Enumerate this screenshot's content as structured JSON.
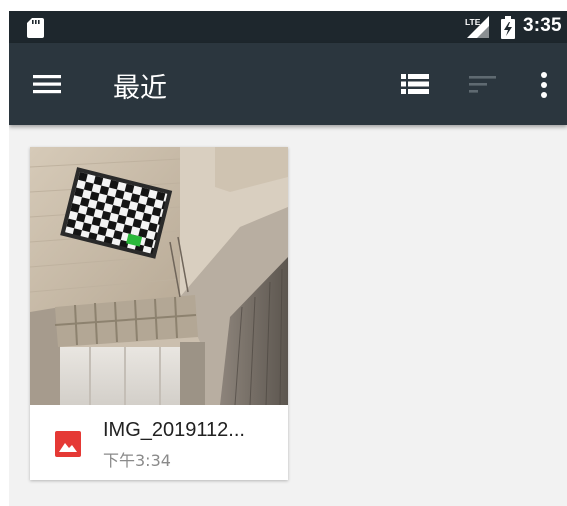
{
  "status_bar": {
    "time": "3:35",
    "network_label": "LTE",
    "icons": [
      "sd-card-icon",
      "lte-signal-icon",
      "battery-charging-icon"
    ]
  },
  "toolbar": {
    "title": "最近",
    "icons": [
      "menu-icon",
      "list-view-icon",
      "sort-icon",
      "more-options-icon"
    ]
  },
  "documents": [
    {
      "name": "IMG_2019112...",
      "time": "下午3:34",
      "type_icon": "image-file-icon",
      "type_icon_color": "#e53935"
    }
  ],
  "colors": {
    "status_bar_bg": "#1e272d",
    "toolbar_bg": "#2b363e",
    "content_bg": "#f2f2f2"
  }
}
